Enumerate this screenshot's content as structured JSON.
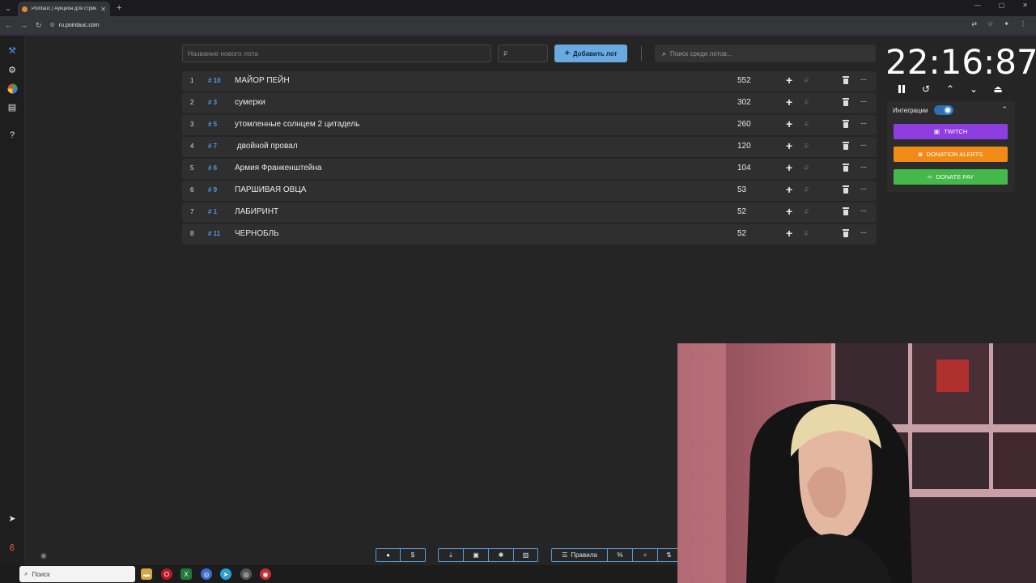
{
  "browser": {
    "tab_title": "Pointauc | Аукцион для стриме...",
    "tab_close": "✕",
    "new_tab": "+",
    "url": "ru.pointauc.com"
  },
  "toolbar_top": {
    "lot_name_placeholder": "Название нового лота",
    "amount_placeholder": "₽",
    "add_button_label": "Добавить лот",
    "search_placeholder": "Поиск среди лотов..."
  },
  "lots": [
    {
      "index": "1",
      "tag": "# 10",
      "name": "МАЙОР ПЕЙН",
      "amount": "552"
    },
    {
      "index": "2",
      "tag": "# 3",
      "name": "сумерки",
      "amount": "302"
    },
    {
      "index": "3",
      "tag": "# 5",
      "name": "утомленные солнцем 2 цитадель",
      "amount": "260"
    },
    {
      "index": "4",
      "tag": "# 7",
      "name": " двойной провал",
      "amount": "120"
    },
    {
      "index": "5",
      "tag": "# 6",
      "name": "Армия Франкенштейна",
      "amount": "104"
    },
    {
      "index": "6",
      "tag": "# 9",
      "name": "ПАРШИВАЯ ОВЦА",
      "amount": "53"
    },
    {
      "index": "7",
      "tag": "# 1",
      "name": "ЛАБИРИНТ",
      "amount": "52"
    },
    {
      "index": "8",
      "tag": "# 11",
      "name": "ЧЕРНОБЛЬ",
      "amount": "52"
    }
  ],
  "row_symbols": {
    "add": "+",
    "currency": "₽",
    "more": "···"
  },
  "timer": {
    "display": "22:16:87"
  },
  "integrations": {
    "label": "Интеграции",
    "enabled": true,
    "buttons": [
      {
        "label": "TWITCH",
        "color": "#8e3ee0"
      },
      {
        "label": "DONATION ALERTS",
        "color": "#f28a17"
      },
      {
        "label": "DONATE PAY",
        "color": "#45b84a"
      }
    ]
  },
  "bottom_toolbar": {
    "rules_label": "Правила",
    "dollar": "$",
    "percent": "%"
  },
  "taskbar": {
    "search_label": "Поиск"
  },
  "colors": {
    "accent": "#4a9de8",
    "add_button": "#6aaae3"
  }
}
